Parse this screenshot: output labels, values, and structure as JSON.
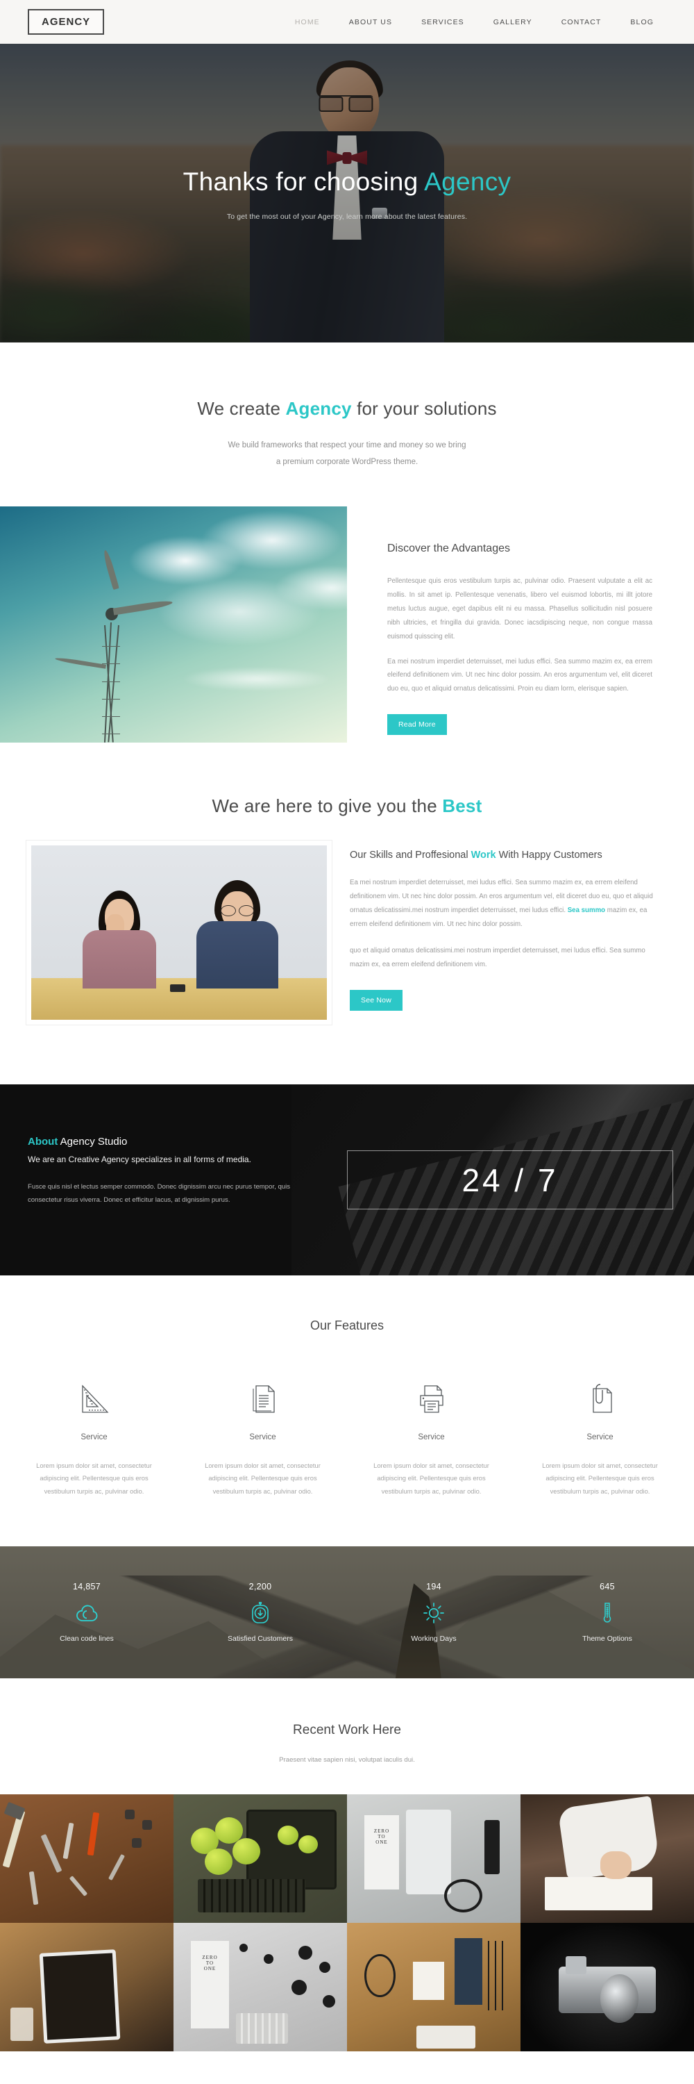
{
  "header": {
    "logo": "AGENCY",
    "nav": [
      {
        "label": "HOME",
        "active": true
      },
      {
        "label": "ABOUT US",
        "active": false
      },
      {
        "label": "SERVICES",
        "active": false
      },
      {
        "label": "GALLERY",
        "active": false
      },
      {
        "label": "CONTACT",
        "active": false
      },
      {
        "label": "BLOG",
        "active": false
      }
    ]
  },
  "hero": {
    "title_plain": "Thanks for choosing ",
    "title_highlight": "Agency",
    "subtitle": "To get the most out of your Agency, learn more about the latest features."
  },
  "wecreate": {
    "title_before": "We create ",
    "title_highlight": "Agency",
    "title_after": " for your solutions",
    "sub_line1": "We build frameworks that respect your time and money so we bring",
    "sub_line2": "a premium corporate WordPress theme."
  },
  "advantages": {
    "image_name": "wind-turbine-photo",
    "title": "Discover the Advantages",
    "paragraph1": "Pellentesque quis eros vestibulum turpis ac, pulvinar odio. Praesent vulputate a elit ac mollis. In sit amet ip. Pellentesque venenatis, libero vel euismod lobortis, mi illt jotore metus luctus augue, eget dapibus elit ni eu massa. Phasellus sollicitudin nisl posuere nibh ultricies, et fringilla dui gravida. Donec iacsdipiscing neque, non congue massa euismod quisscing elit.",
    "paragraph2": "Ea mei nostrum imperdiet deterruisset, mei ludus effici. Sea summo mazim ex, ea errem eleifend definitionem vim. Ut nec hinc dolor possim. An eros argumentum vel, elit diceret duo eu, quo et aliquid ornatus delicatissimi. Proin eu diam lorm, elerisque sapien.",
    "button": "Read More"
  },
  "best": {
    "title_before": "We are here to give you the ",
    "title_highlight": "Best"
  },
  "skills": {
    "image_name": "two-customers-photo",
    "title_part1": "Our Skills and Proffesional ",
    "title_highlight": "Work",
    "title_part2": " With Happy Customers",
    "paragraph1_a": "Ea mei nostrum imperdiet deterruisset, mei ludus effici. Sea summo mazim ex, ea errem eleifend definitionem vim. Ut nec hinc dolor possim. An eros argumentum vel, elit diceret duo eu, quo et aliquid ornatus delicatissimi.mei nostrum imperdiet deterruisset, mei ludus effici. ",
    "paragraph1_hl": "Sea summo",
    "paragraph1_b": " mazim ex, ea errem eleifend definitionem vim. Ut nec hinc dolor possim.",
    "paragraph2": "quo et aliquid ornatus delicatissimi.mei nostrum imperdiet deterruisset, mei ludus effici. Sea summo mazim ex, ea errem eleifend definitionem vim.",
    "button": "See Now"
  },
  "about": {
    "title_highlight": "About",
    "title_rest": " Agency Studio",
    "lead": "We are an Creative Agency specializes in all forms of media.",
    "paragraph": "Fusce quis nisl et lectus semper commodo. Donec dignissim arcu nec purus tempor, quis consectetur risus viverra. Donec et efficitur lacus, at dignissim purus.",
    "badge": "24 / 7"
  },
  "features": {
    "title": "Our Features",
    "items": [
      {
        "icon": "set-square-ruler-icon",
        "name": "Service",
        "desc": "Lorem ipsum dolor sit amet, consectetur adipiscing elit. Pellentesque quis eros vestibulum turpis ac, pulvinar odio."
      },
      {
        "icon": "documents-icon",
        "name": "Service",
        "desc": "Lorem ipsum dolor sit amet, consectetur adipiscing elit. Pellentesque quis eros vestibulum turpis ac, pulvinar odio."
      },
      {
        "icon": "printer-icon",
        "name": "Service",
        "desc": "Lorem ipsum dolor sit amet, consectetur adipiscing elit. Pellentesque quis eros vestibulum turpis ac, pulvinar odio."
      },
      {
        "icon": "notepad-clip-icon",
        "name": "Service",
        "desc": "Lorem ipsum dolor sit amet, consectetur adipiscing elit. Pellentesque quis eros vestibulum turpis ac, pulvinar odio."
      }
    ]
  },
  "stats": {
    "items": [
      {
        "value": "14,857",
        "icon": "cloud-icon",
        "label": "Clean code lines"
      },
      {
        "value": "2,200",
        "icon": "download-badge-icon",
        "label": "Satisfied Customers"
      },
      {
        "value": "194",
        "icon": "sun-icon",
        "label": "Working Days"
      },
      {
        "value": "645",
        "icon": "thermometer-icon",
        "label": "Theme Options"
      }
    ]
  },
  "recent": {
    "title": "Recent Work Here",
    "subtitle": "Praesent vitae sapien nisi, volutpat iaculis dui.",
    "gallery": [
      {
        "name": "tools-on-wood-photo"
      },
      {
        "name": "green-apples-keyboard-photo"
      },
      {
        "name": "zero-to-one-flatlay-photo"
      },
      {
        "name": "writing-in-notebook-photo"
      },
      {
        "name": "tablet-on-desk-photo"
      },
      {
        "name": "stickers-flatlay-photo"
      },
      {
        "name": "stationery-desk-photo"
      },
      {
        "name": "vintage-camera-photo"
      }
    ]
  },
  "colors": {
    "accent": "#2cc7c7",
    "header_bg": "#f7f6f4",
    "dark_bg": "#0e0e0e",
    "text": "#4a4a4a",
    "muted": "#9b9b9b"
  }
}
